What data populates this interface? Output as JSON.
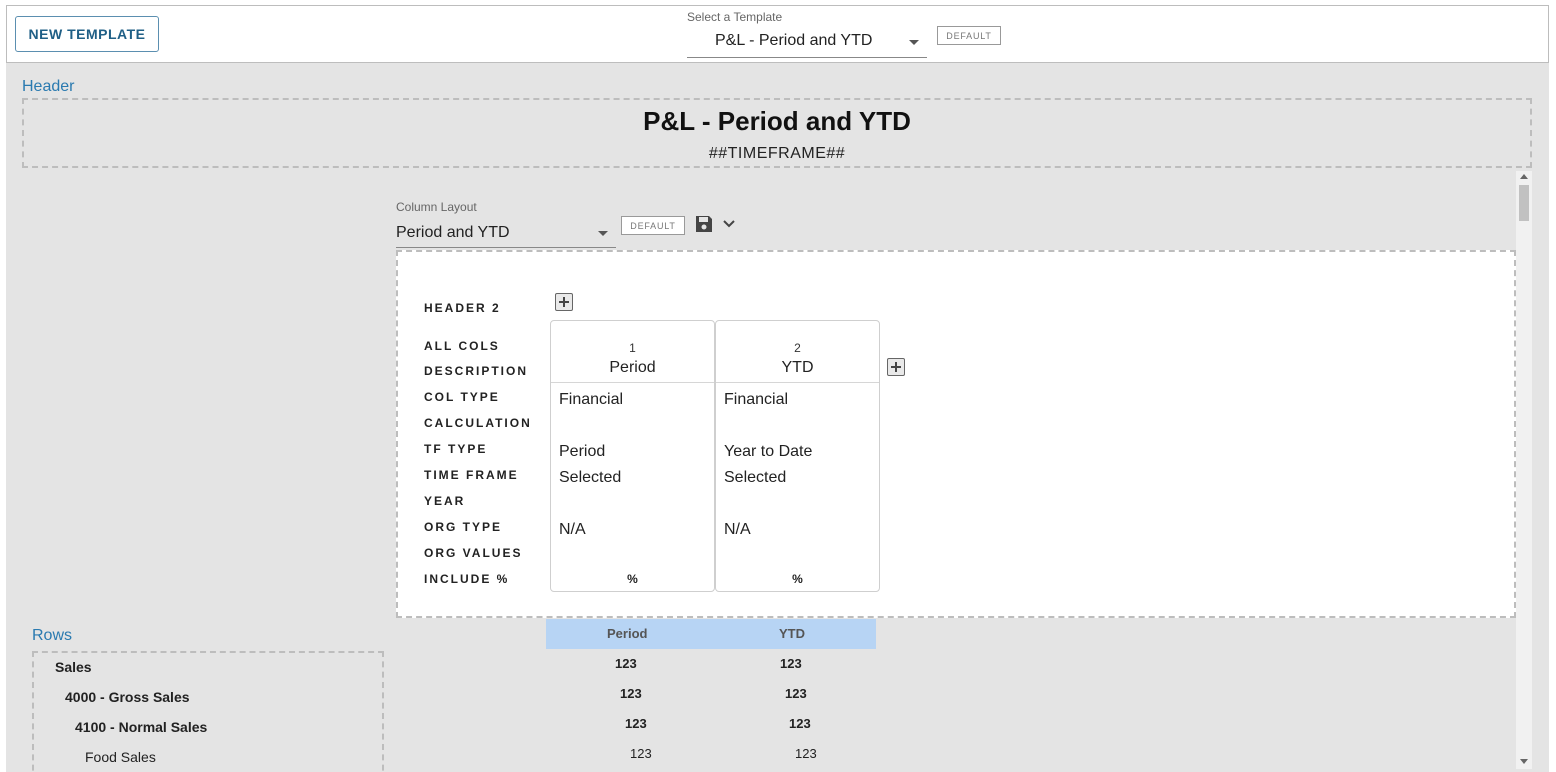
{
  "toolbar": {
    "new_template_label": "NEW TEMPLATE",
    "template_select_label": "Select a Template",
    "template_select_value": "P&L - Period and YTD",
    "default_badge": "DEFAULT"
  },
  "header_section": {
    "label": "Header",
    "title": "P&L - Period and YTD",
    "subtitle": "##TIMEFRAME##"
  },
  "column_layout": {
    "label": "Column Layout",
    "value": "Period and YTD",
    "default_badge": "DEFAULT",
    "icons": [
      "save-icon",
      "chevron-down-icon",
      "plus-icon"
    ],
    "row_labels": [
      "HEADER 2",
      "ALL COLS",
      "DESCRIPTION",
      "COL TYPE",
      "CALCULATION",
      "TF TYPE",
      "TIME FRAME",
      "YEAR",
      "ORG TYPE",
      "ORG VALUES",
      "INCLUDE %"
    ],
    "columns": [
      {
        "number": "1",
        "name": "Period",
        "col_type": "Financial",
        "calculation": "",
        "tf_type": "Period",
        "time_frame": "Selected",
        "year": "",
        "org_type": "N/A",
        "org_values": "",
        "include_pct": "%"
      },
      {
        "number": "2",
        "name": "YTD",
        "col_type": "Financial",
        "calculation": "",
        "tf_type": "Year to Date",
        "time_frame": "Selected",
        "year": "",
        "org_type": "N/A",
        "org_values": "",
        "include_pct": "%"
      }
    ]
  },
  "rows_section": {
    "label": "Rows",
    "items": [
      {
        "label": "Sales",
        "bold": true
      },
      {
        "label": "4000 - Gross Sales",
        "bold": true
      },
      {
        "label": "4100 - Normal Sales",
        "bold": true
      },
      {
        "label": "Food Sales",
        "bold": false
      }
    ]
  },
  "grid": {
    "headers": [
      "Period",
      "YTD"
    ],
    "rows": [
      [
        "123",
        "123"
      ],
      [
        "123",
        "123"
      ],
      [
        "123",
        "123"
      ],
      [
        "123",
        "123"
      ]
    ]
  },
  "colors": {
    "accent": "#2a7ab0",
    "grid_header_bg": "#b7d4f4",
    "canvas_bg": "#e4e4e4"
  }
}
